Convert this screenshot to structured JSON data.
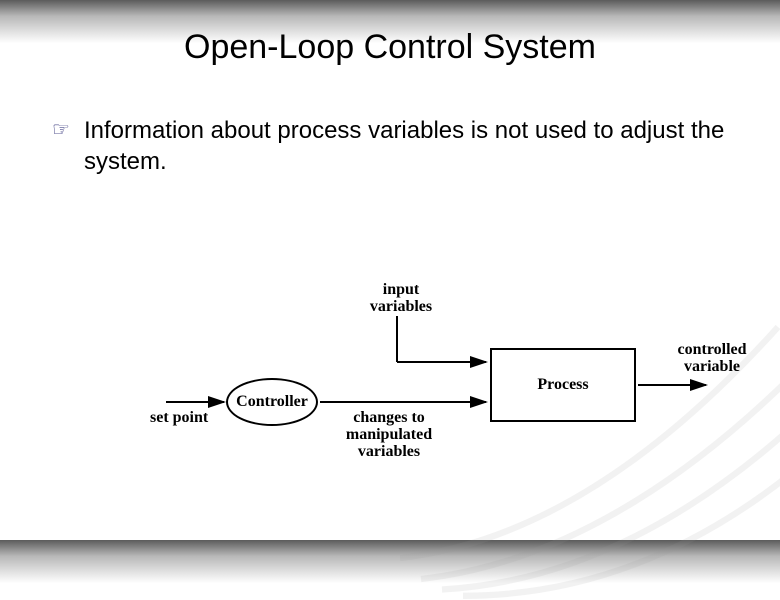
{
  "title": "Open-Loop Control System",
  "bullet": {
    "text": "Information about process variables is not used to adjust the system."
  },
  "diagram": {
    "set_point": "set point",
    "controller": "Controller",
    "input_variables": "input\nvariables",
    "changes_to": "changes to\nmanipulated\nvariables",
    "process": "Process",
    "controlled_variable": "controlled\nvariable"
  }
}
